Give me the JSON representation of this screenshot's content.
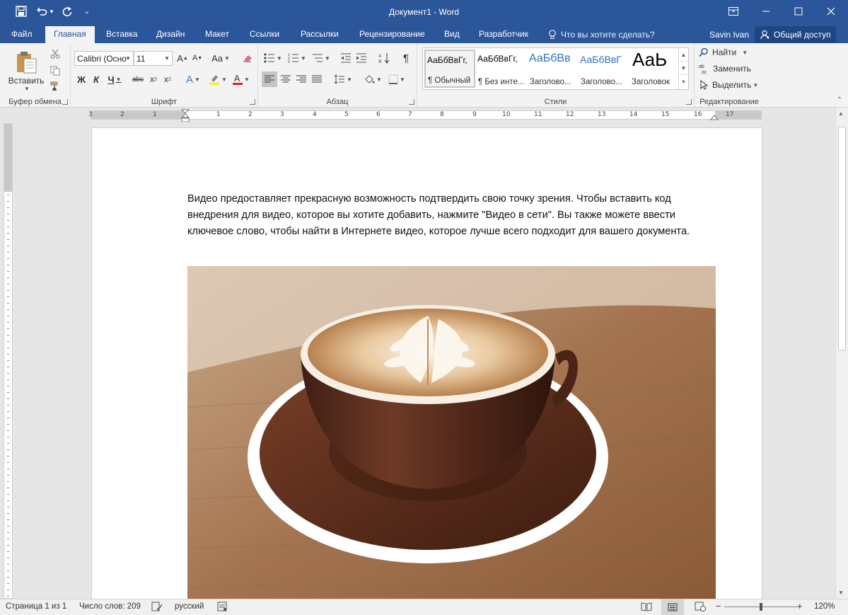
{
  "window": {
    "title": "Документ1 - Word",
    "accent": "#2b579a"
  },
  "quick_access": {
    "save_icon": "save-icon",
    "undo_icon": "undo-icon",
    "redo_icon": "redo-icon"
  },
  "tabs": [
    {
      "label": "Файл"
    },
    {
      "label": "Главная"
    },
    {
      "label": "Вставка"
    },
    {
      "label": "Дизайн"
    },
    {
      "label": "Макет"
    },
    {
      "label": "Ссылки"
    },
    {
      "label": "Рассылки"
    },
    {
      "label": "Рецензирование"
    },
    {
      "label": "Вид"
    },
    {
      "label": "Разработчик"
    }
  ],
  "active_tab": "Главная",
  "tell_me": "Что вы хотите сделать?",
  "user": "Savin Ivan",
  "share": "Общий доступ",
  "ribbon": {
    "clipboard": {
      "label": "Буфер обмена",
      "paste": "Вставить"
    },
    "font": {
      "label": "Шрифт",
      "font_name": "Calibri (Осно",
      "font_size": "11",
      "bold": "Ж",
      "italic": "К",
      "underline": "Ч",
      "strike": "abc"
    },
    "paragraph": {
      "label": "Абзац"
    },
    "styles": {
      "label": "Стили",
      "items": [
        {
          "sample": "АаБбВвГг,",
          "name": "¶ Обычный"
        },
        {
          "sample": "АаБбВвГг,",
          "name": "¶ Без инте..."
        },
        {
          "sample": "АаБбВв",
          "name": "Заголово..."
        },
        {
          "sample": "АаБбВвГ",
          "name": "Заголово..."
        },
        {
          "sample": "АаЬ",
          "name": "Заголовок"
        }
      ]
    },
    "editing": {
      "label": "Редактирование",
      "find": "Найти",
      "replace": "Заменить",
      "select": "Выделить"
    }
  },
  "ruler": {
    "marks": [
      "3",
      "2",
      "1",
      "1",
      "2",
      "3",
      "4",
      "5",
      "6",
      "7",
      "8",
      "9",
      "10",
      "11",
      "12",
      "13",
      "14",
      "15",
      "16",
      "17"
    ]
  },
  "document": {
    "paragraph": "Видео предоставляет прекрасную возможность подтвердить свою точку зрения. Чтобы вставить код внедрения для видео, которое вы хотите добавить, нажмите \"Видео в сети\". Вы также можете ввести ключевое слово, чтобы найти в Интернете видео, которое лучше всего подходит для вашего документа."
  },
  "status": {
    "page": "Страница 1 из 1",
    "words": "Число слов: 209",
    "language": "русский",
    "zoom": "120%"
  }
}
